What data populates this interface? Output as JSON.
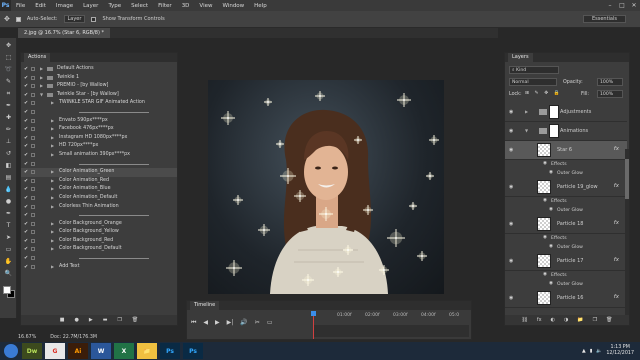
{
  "app": {
    "logo": "Ps",
    "menu": [
      "File",
      "Edit",
      "Image",
      "Layer",
      "Type",
      "Select",
      "Filter",
      "3D",
      "View",
      "Window",
      "Help"
    ],
    "window_controls": [
      "–",
      "□",
      "✕"
    ]
  },
  "options_bar": {
    "auto_select_label": "Auto-Select:",
    "auto_select_value": "Layer",
    "transform_label": "Show Transform Controls",
    "workspace": "Essentials"
  },
  "document": {
    "tab_title": "2.jpg @ 16.7% (Star 6, RGB/8) *"
  },
  "actions_panel": {
    "title": "Actions",
    "rows": [
      {
        "text": "Default Actions",
        "kind": "set"
      },
      {
        "text": "Twinkle 1",
        "kind": "set"
      },
      {
        "text": "PREMIO - [by Wallow]",
        "kind": "set"
      },
      {
        "text": "Twinkle Star - [by Wallow]",
        "kind": "set-open"
      },
      {
        "text": "TWINKLE STAR GIF Animated Action",
        "kind": "action"
      },
      {
        "text": "",
        "kind": "sep"
      },
      {
        "text": "Envato 590px****px",
        "kind": "action"
      },
      {
        "text": "Facebook 476px****px",
        "kind": "action"
      },
      {
        "text": "Instagram HD 1080px****px",
        "kind": "action"
      },
      {
        "text": "HD 720px****px",
        "kind": "action"
      },
      {
        "text": "Small animation 390px****px",
        "kind": "action"
      },
      {
        "text": "",
        "kind": "sep"
      },
      {
        "text": "Color Animation_Green",
        "kind": "action-sel"
      },
      {
        "text": "Color Animation_Red",
        "kind": "action"
      },
      {
        "text": "Color Animation_Blue",
        "kind": "action"
      },
      {
        "text": "Color Animation_Default",
        "kind": "action"
      },
      {
        "text": "Colorless Thin Animation",
        "kind": "action"
      },
      {
        "text": "",
        "kind": "sep"
      },
      {
        "text": "Color Background_Orange",
        "kind": "action"
      },
      {
        "text": "Color Background_Yellow",
        "kind": "action"
      },
      {
        "text": "Color Background_Red",
        "kind": "action"
      },
      {
        "text": "Color Background_Default",
        "kind": "action"
      },
      {
        "text": "",
        "kind": "sep"
      },
      {
        "text": "Add Text",
        "kind": "action"
      }
    ],
    "footer_icons": [
      "■",
      "●",
      "▶",
      "▬",
      "❐",
      "🗑"
    ]
  },
  "status": {
    "zoom": "16.67%",
    "doc_size": "Doc: 22.7M/176.3M"
  },
  "timeline": {
    "title": "Timeline",
    "controls": [
      "⏮",
      "◀",
      "▶",
      "▶|",
      "🔊",
      "✂",
      "▭"
    ],
    "ticks": [
      "01:00f",
      "02:00f",
      "03:00f",
      "04:00f",
      "05:0"
    ]
  },
  "layers_panel": {
    "title": "Layers",
    "kind_label": "Kind",
    "blend_mode": "Normal",
    "opacity_label": "Opacity:",
    "opacity_value": "100%",
    "lock_label": "Lock:",
    "fill_label": "Fill:",
    "fill_value": "100%",
    "layers": [
      {
        "name": "Adjustments",
        "type": "group"
      },
      {
        "name": "Animations",
        "type": "group"
      },
      {
        "name": "Star 6",
        "type": "layer",
        "fx": "fx",
        "selected": true
      },
      {
        "name": "Particle 19_glow",
        "type": "layer",
        "fx": "fx"
      },
      {
        "name": "Particle 18",
        "type": "layer",
        "fx": "fx"
      },
      {
        "name": "Particle 17",
        "type": "layer",
        "fx": "fx"
      },
      {
        "name": "Particle 16",
        "type": "layer",
        "fx": "fx"
      }
    ],
    "effects_label": "Effects",
    "outer_glow_label": "Outer Glow",
    "footer_icons": [
      "⛓",
      "fx",
      "◐",
      "◑",
      "📁",
      "❐",
      "🗑"
    ]
  },
  "taskbar": {
    "apps": [
      {
        "label": "Dw",
        "color": "#3c4a1e",
        "text_color": "#b8e05a"
      },
      {
        "label": "G",
        "color": "#e8e8e8",
        "text_color": "#d93025"
      },
      {
        "label": "Ai",
        "color": "#3a1d0a",
        "text_color": "#ff9a00"
      },
      {
        "label": "W",
        "color": "#2b579a",
        "text_color": "#ffffff"
      },
      {
        "label": "X",
        "color": "#217346",
        "text_color": "#ffffff"
      },
      {
        "label": "📁",
        "color": "#f0c040",
        "text_color": "#7a5a00"
      },
      {
        "label": "Ps",
        "color": "#0a2a44",
        "text_color": "#31a8ff"
      },
      {
        "label": "Ps",
        "color": "#0a2a44",
        "text_color": "#31a8ff"
      }
    ],
    "time": "1:13 PM",
    "date": "12/12/2017"
  }
}
